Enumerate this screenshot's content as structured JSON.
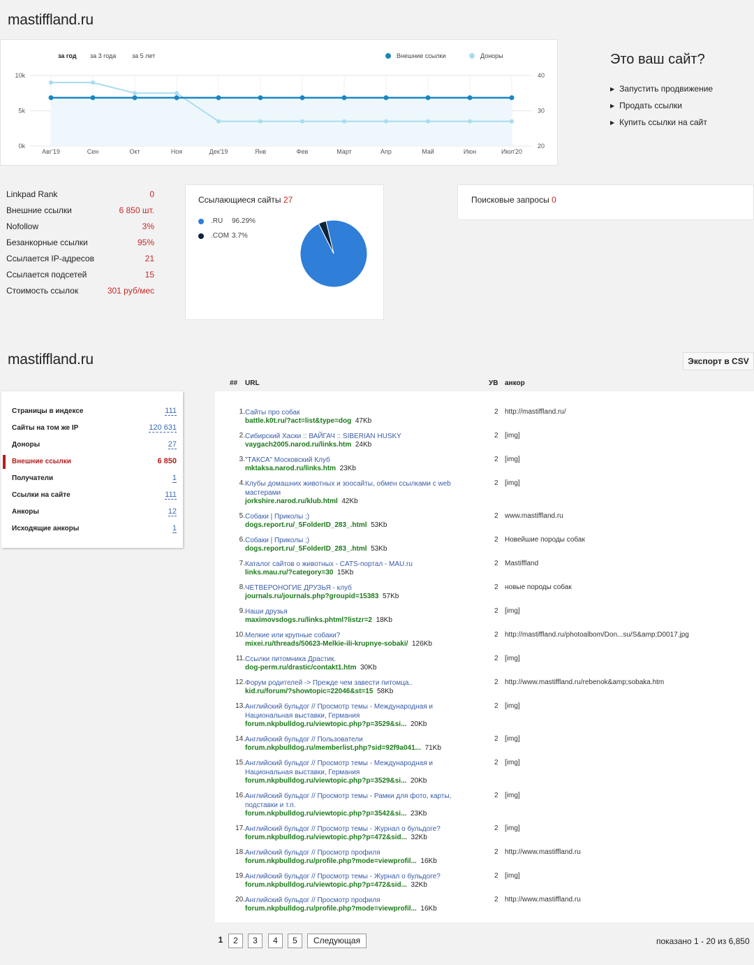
{
  "header": {
    "site_title": "mastiffland.ru"
  },
  "chart": {
    "periods": [
      "за год",
      "за 3 года",
      "за 5 лет"
    ],
    "active_period": "за год",
    "legend": [
      "Внешние ссылки",
      "Доноры"
    ],
    "colors": {
      "external_links": "#1a86c2",
      "donors": "#a9dcf0"
    },
    "left_ticks": [
      "10k",
      "5k",
      "0k"
    ],
    "right_ticks": [
      "40",
      "30",
      "20"
    ],
    "x_ticks": [
      "Авг'19",
      "Сен",
      "Окт",
      "Ноя",
      "Дек'19",
      "Янв",
      "Фев",
      "Март",
      "Апр",
      "Май",
      "Июн",
      "Июл'20"
    ]
  },
  "chart_data": {
    "type": "line",
    "categories": [
      "Авг'19",
      "Сен",
      "Окт",
      "Ноя",
      "Дек'19",
      "Янв",
      "Фев",
      "Март",
      "Апр",
      "Май",
      "Июн",
      "Июл'20"
    ],
    "series": [
      {
        "name": "Внешние ссылки",
        "axis": "left",
        "values": [
          6850,
          6850,
          6850,
          6850,
          6850,
          6850,
          6850,
          6850,
          6850,
          6850,
          6850,
          6850
        ]
      },
      {
        "name": "Доноры",
        "axis": "right",
        "values": [
          38,
          38,
          35,
          35,
          27,
          27,
          27,
          27,
          27,
          27,
          27,
          27
        ]
      }
    ],
    "ylim_left": [
      0,
      10000
    ],
    "ylim_right": [
      20,
      40
    ],
    "grid": true,
    "legend_position": "top-right"
  },
  "promo": {
    "title": "Это ваш сайт?",
    "items": [
      "Запустить продвижение",
      "Продать ссылки",
      "Купить ссылки на сайт"
    ]
  },
  "stats": [
    {
      "label": "Linkpad Rank",
      "value": "0"
    },
    {
      "label": "Внешние ссылки",
      "value": "6 850 шт."
    },
    {
      "label": "Nofollow",
      "value": "3%"
    },
    {
      "label": "Безанкорные ссылки",
      "value": "95%"
    },
    {
      "label": "Ссылается IP-адресов",
      "value": "21"
    },
    {
      "label": "Ссылается подсетей",
      "value": "15"
    },
    {
      "label": "Стоимость ссылок",
      "value": "301 руб/мес"
    }
  ],
  "linking_sites": {
    "title": "Ссылающиеся сайты",
    "count": "27",
    "slices": [
      {
        "label": ".RU",
        "pct": "96.29%",
        "value": 96.29,
        "color": "#2f7ed8"
      },
      {
        "label": ".COM",
        "pct": "3.7%",
        "value": 3.7,
        "color": "#0d233a"
      }
    ]
  },
  "search_queries": {
    "title": "Поисковые запросы",
    "count": "0"
  },
  "section": {
    "site_title": "mastiffland.ru",
    "export_label": "Экспорт в CSV"
  },
  "nav": [
    {
      "label": "Страницы в индексе",
      "count": "111"
    },
    {
      "label": "Сайты на том же IP",
      "count": "120 631"
    },
    {
      "label": "Доноры",
      "count": "27"
    },
    {
      "label": "Внешние ссылки",
      "count": "6 850",
      "active": true
    },
    {
      "label": "Получатели",
      "count": "1"
    },
    {
      "label": "Ссылки на сайте",
      "count": "111"
    },
    {
      "label": "Анкоры",
      "count": "12"
    },
    {
      "label": "Исходящие анкоры",
      "count": "1"
    }
  ],
  "table": {
    "headers": {
      "num": "##",
      "url": "URL",
      "uv": "УВ",
      "anchor": "анкор"
    },
    "rows": [
      {
        "n": "1.",
        "title": "Сайты про собак",
        "url": "battle.k0t.ru/?act=list&type=dog",
        "size": "47Kb",
        "uv": "2",
        "anchor": "http://mastiffland.ru/"
      },
      {
        "n": "2.",
        "title": "Сибирский Хаски :: ВАЙГАЧ :: SIBERIAN HUSKY",
        "url": "vaygach2005.narod.ru/links.htm",
        "size": "24Kb",
        "uv": "2",
        "anchor": "[img]"
      },
      {
        "n": "3.",
        "title": "\"ТАКСА\" Московский Клуб",
        "url": "mktaksa.narod.ru/links.htm",
        "size": "23Kb",
        "uv": "2",
        "anchor": "[img]"
      },
      {
        "n": "4.",
        "title": "Клубы домашних животных и зоосайты, обмен ссылками с web мастерами",
        "url": "jorkshire.narod.ru/klub.html",
        "size": "42Kb",
        "uv": "2",
        "anchor": "[img]"
      },
      {
        "n": "5.",
        "title": "Собаки | Приколы ;)",
        "url": "dogs.report.ru/_5FolderID_283_.html",
        "size": "53Kb",
        "uv": "2",
        "anchor": "www.mastiffland.ru"
      },
      {
        "n": "6.",
        "title": "Собаки | Приколы ;)",
        "url": "dogs.report.ru/_5FolderID_283_.html",
        "size": "53Kb",
        "uv": "2",
        "anchor": "Новейшие породы собак"
      },
      {
        "n": "7.",
        "title": "Каталог сайтов о животных - CATS-портал - MAU.ru",
        "url": "links.mau.ru/?category=30",
        "size": "15Kb",
        "uv": "2",
        "anchor": "Mastiffland"
      },
      {
        "n": "8.",
        "title": "ЧЕТВЕРОНОГИЕ ДРУЗЬЯ - клуб",
        "url": "journals.ru/journals.php?groupid=15383",
        "size": "57Kb",
        "uv": "2",
        "anchor": "новые породы собак"
      },
      {
        "n": "9.",
        "title": "Наши друзья",
        "url": "maximovsdogs.ru/links.phtml?listzr=2",
        "size": "18Kb",
        "uv": "2",
        "anchor": "[img]"
      },
      {
        "n": "10.",
        "title": "Мелкие или крупные собаки?",
        "url": "mixei.ru/threads/50623-Melkie-ili-krupnye-sobaki/",
        "size": "126Kb",
        "uv": "2",
        "anchor": "http://mastiffland.ru/photoalbom/Don...su/S&amp;D0017.jpg"
      },
      {
        "n": "11.",
        "title": "Ссылки питомника Драстик.",
        "url": "dog-perm.ru/drastic/contakt1.htm",
        "size": "30Kb",
        "uv": "2",
        "anchor": "[img]"
      },
      {
        "n": "12.",
        "title": "Форум родителей -> Прежде чем завести питомца..",
        "url": "kid.ru/forum/?showtopic=22046&st=15",
        "size": "58Kb",
        "uv": "2",
        "anchor": "http://www.mastiffland.ru/rebenok&amp;sobaka.htm"
      },
      {
        "n": "13.",
        "title": "Английский бульдог // Просмотр темы - Международная и Национальная выставки, Германия",
        "url": "forum.nkpbulldog.ru/viewtopic.php?p=3529&si...",
        "size": "20Kb",
        "uv": "2",
        "anchor": "[img]"
      },
      {
        "n": "14.",
        "title": "Английский бульдог // Пользователи",
        "url": "forum.nkpbulldog.ru/memberlist.php?sid=92f9a041...",
        "size": "71Kb",
        "uv": "2",
        "anchor": "[img]"
      },
      {
        "n": "15.",
        "title": "Английский бульдог // Просмотр темы - Международная и Национальная выставки, Германия",
        "url": "forum.nkpbulldog.ru/viewtopic.php?p=3529&si...",
        "size": "20Kb",
        "uv": "2",
        "anchor": "[img]"
      },
      {
        "n": "16.",
        "title": "Английский бульдог // Просмотр темы - Рамки для фото, карты, подставки и т.п.",
        "url": "forum.nkpbulldog.ru/viewtopic.php?p=3542&si...",
        "size": "23Kb",
        "uv": "2",
        "anchor": "[img]"
      },
      {
        "n": "17.",
        "title": "Английский бульдог // Просмотр темы - Журнал о бульдоге?",
        "url": "forum.nkpbulldog.ru/viewtopic.php?p=472&sid...",
        "size": "32Kb",
        "uv": "2",
        "anchor": "[img]"
      },
      {
        "n": "18.",
        "title": "Английский бульдог // Просмотр профиля",
        "url": "forum.nkpbulldog.ru/profile.php?mode=viewprofil...",
        "size": "16Kb",
        "uv": "2",
        "anchor": "http://www.mastiffland.ru"
      },
      {
        "n": "19.",
        "title": "Английский бульдог // Просмотр темы - Журнал о бульдоге?",
        "url": "forum.nkpbulldog.ru/viewtopic.php?p=472&sid...",
        "size": "32Kb",
        "uv": "2",
        "anchor": "[img]"
      },
      {
        "n": "20.",
        "title": "Английский бульдог // Просмотр профиля",
        "url": "forum.nkpbulldog.ru/profile.php?mode=viewprofil...",
        "size": "16Kb",
        "uv": "2",
        "anchor": "http://www.mastiffland.ru"
      }
    ]
  },
  "pagination": {
    "pages": [
      "1",
      "2",
      "3",
      "4",
      "5"
    ],
    "current": "1",
    "next_label": "Следующая",
    "summary": "показано 1 - 20 из 6,850"
  }
}
